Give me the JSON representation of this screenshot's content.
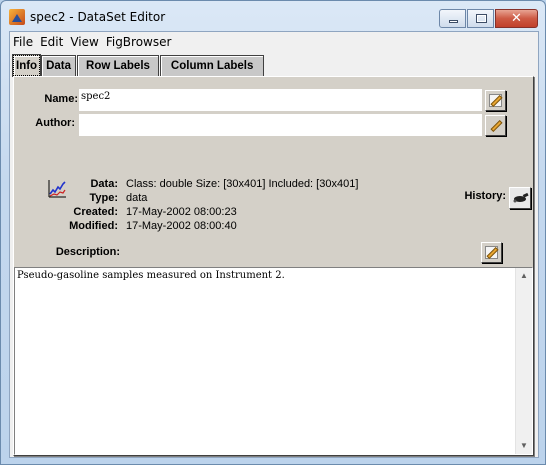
{
  "window": {
    "title": "spec2 - DataSet Editor"
  },
  "menu": [
    "File",
    "Edit",
    "View",
    "FigBrowser"
  ],
  "tabs": [
    "Info",
    "Data",
    "Row Labels",
    "Column Labels"
  ],
  "labels": {
    "name": "Name:",
    "author": "Author:",
    "history": "History:",
    "description": "Description:"
  },
  "fields": {
    "name_value": "spec2",
    "author_value": ""
  },
  "info": [
    {
      "key": "Data:",
      "value": "Class: double  Size: [30x401]  Included: [30x401]"
    },
    {
      "key": "Type:",
      "value": "data"
    },
    {
      "key": "Created:",
      "value": "17-May-2002 08:00:23"
    },
    {
      "key": "Modified:",
      "value": "17-May-2002 08:00:40"
    }
  ],
  "description_text": "Pseudo-gasoline samples measured on Instrument 2.",
  "icons": {
    "app": "matlab-icon",
    "edit": "pencil-edit-icon",
    "data": "line-chart-icon",
    "history": "history-icon"
  },
  "colors": {
    "close_button": "#c1402b",
    "panel": "#d4d0c8"
  }
}
